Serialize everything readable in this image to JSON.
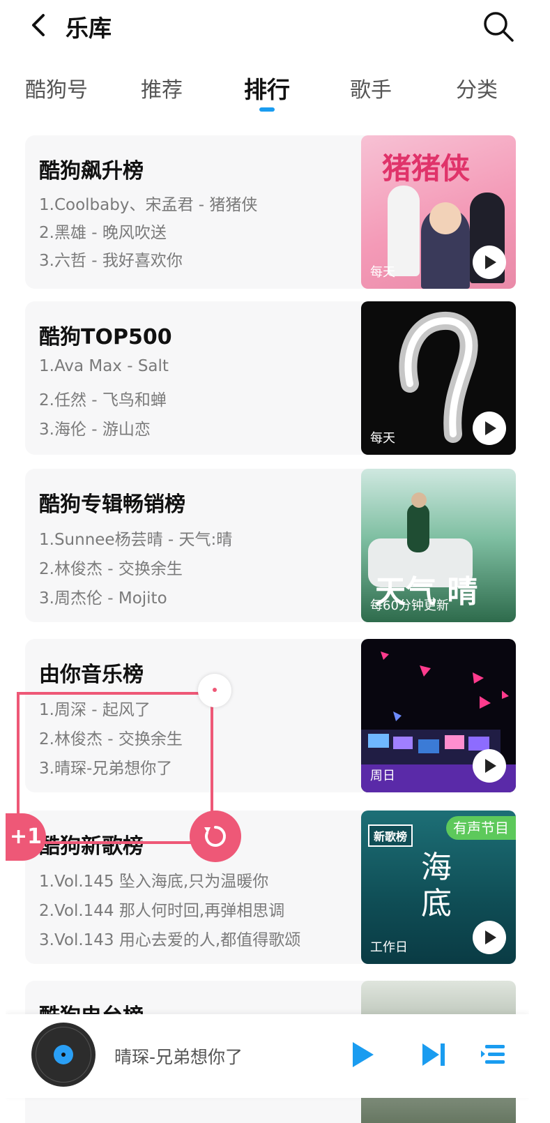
{
  "header": {
    "title": "乐库"
  },
  "tabs": [
    {
      "label": "酷狗号",
      "active": false
    },
    {
      "label": "推荐",
      "active": false
    },
    {
      "label": "排行",
      "active": true
    },
    {
      "label": "歌手",
      "active": false
    },
    {
      "label": "分类",
      "active": false
    }
  ],
  "charts": [
    {
      "name": "酷狗飙升榜",
      "lines": [
        "1.Coolbaby、宋孟君 - 猪猪侠",
        "2.黑雄 - 晚风吹送",
        "3.六哲 - 我好喜欢你"
      ],
      "cover_text": "猪猪侠",
      "frequency": "每天"
    },
    {
      "name": "酷狗TOP500",
      "lines": [
        "1.Ava Max - Salt",
        "2.任然 - 飞鸟和蝉",
        "3.海伦 - 游山恋"
      ],
      "frequency": "每天"
    },
    {
      "name": "酷狗专辑畅销榜",
      "lines": [
        "1.Sunnee杨芸晴 - 天气:晴",
        "2.林俊杰 - 交换余生",
        "3.周杰伦 - Mojito"
      ],
      "cover_text": "天气 晴",
      "frequency": "每60分钟更新"
    },
    {
      "name": "由你音乐榜",
      "lines": [
        "1.周深 - 起风了",
        "2.林俊杰 - 交换余生",
        "3.晴琛-兄弟想你了"
      ],
      "frequency": "周日"
    },
    {
      "name": "酷狗新歌榜",
      "lines": [
        "1.Vol.145 坠入海底,只为温暖你",
        "2.Vol.144 那人何时回,再弹相思调",
        "3.Vol.143 用心去爱的人,都值得歌颂"
      ],
      "cover_text": "海底",
      "cover_label": "新歌榜",
      "badge": "有声节目",
      "frequency": "工作日"
    },
    {
      "name": "酷狗电台榜",
      "lines": []
    }
  ],
  "overlay": {
    "plus_label": "+1"
  },
  "player": {
    "now_playing": "晴琛-兄弟想你了"
  },
  "colors": {
    "accent": "#1a9cf0",
    "overlay": "#ee5877"
  }
}
